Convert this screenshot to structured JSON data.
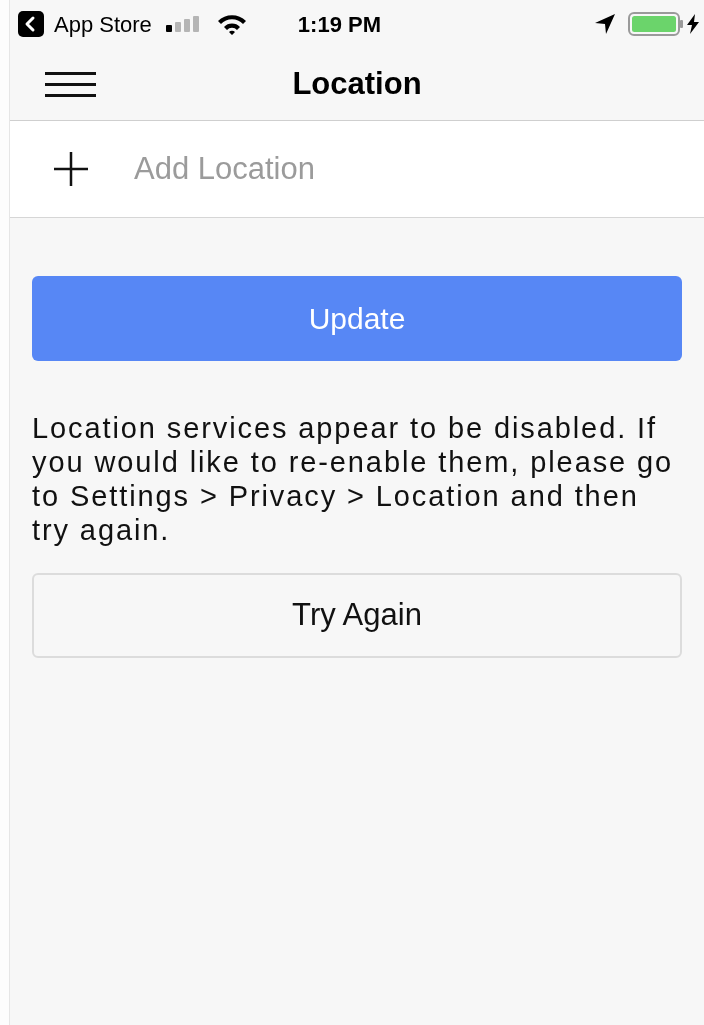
{
  "status_bar": {
    "back_app": "App Store",
    "time": "1:19 PM"
  },
  "nav_bar": {
    "title": "Location"
  },
  "add_location": {
    "placeholder": "Add Location"
  },
  "update_button": "Update",
  "message": "Location services appear to be disabled. If you would like to re-enable them, please go to Settings > Privacy > Location and then try again.",
  "try_again_button": "Try Again"
}
